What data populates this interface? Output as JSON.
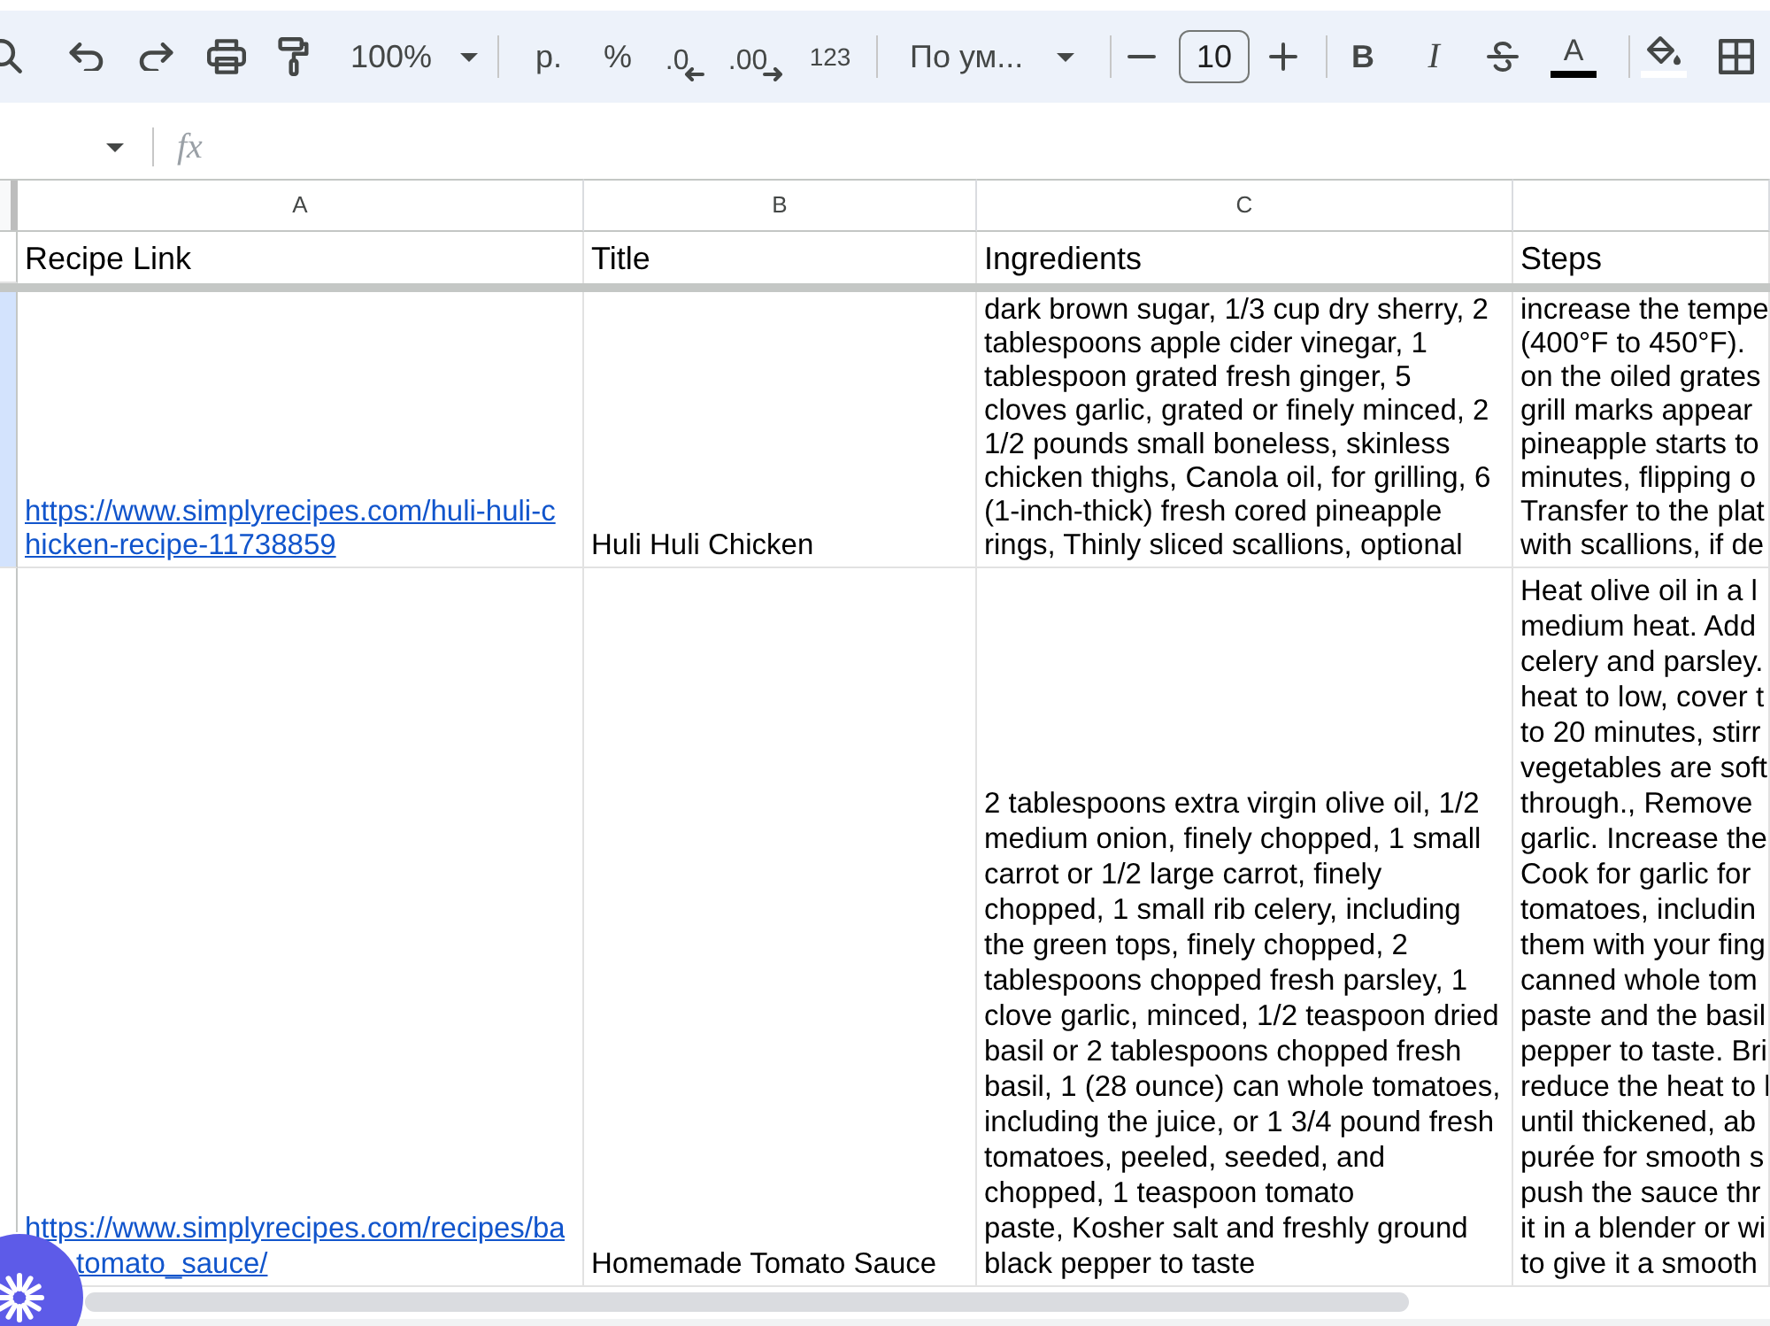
{
  "toolbar": {
    "zoom": "100%",
    "currency": "р.",
    "percent": "%",
    "decrease_decimal": ".0",
    "increase_decimal": ".00",
    "number_format": "123",
    "font": "По ум...",
    "font_size": "10",
    "bold": "B",
    "italic": "I",
    "text_color": "A"
  },
  "formula_bar": {
    "fx": "fx"
  },
  "sheet": {
    "column_letters": [
      "A",
      "B",
      "C"
    ],
    "header_row": {
      "selected": false,
      "cells": [
        "Recipe Link",
        "Title",
        "Ingredients",
        "Steps"
      ]
    },
    "rows": [
      {
        "selected": true,
        "link": [
          "https://www.simplyrecipes.com/huli-huli-c",
          "hicken-recipe-11738859"
        ],
        "title": "Huli Huli Chicken",
        "ingredients": [
          "dark brown sugar, 1/3 cup dry sherry, 2",
          "tablespoons apple cider vinegar, 1",
          "tablespoon grated fresh ginger, 5",
          "cloves garlic, grated or finely minced, 2",
          "1/2 pounds small boneless, skinless",
          "chicken thighs, Canola oil, for grilling, 6",
          "(1-inch-thick) fresh cored pineapple",
          "rings, Thinly sliced scallions, optional"
        ],
        "steps": [
          "increase the tempe",
          "(400°F to 450°F).",
          "on the oiled grates",
          "grill marks appear",
          "pineapple starts to",
          "minutes, flipping o",
          "Transfer to the plat",
          "with scallions, if de"
        ]
      },
      {
        "selected": false,
        "link": [
          "https://www.simplyrecipes.com/recipes/ba",
          "tomato_sauce/"
        ],
        "title": "Homemade Tomato Sauce",
        "ingredients": [
          "2 tablespoons extra virgin olive oil, 1/2",
          "medium onion, finely chopped, 1 small",
          "carrot or 1/2 large carrot, finely",
          "chopped, 1 small rib celery, including",
          "the green tops, finely chopped, 2",
          "tablespoons chopped fresh parsley, 1",
          "clove garlic, minced, 1/2 teaspoon dried",
          "basil or 2 tablespoons chopped fresh",
          "basil, 1 (28 ounce) can whole tomatoes,",
          "including the juice, or 1 3/4 pound fresh",
          "tomatoes, peeled, seeded, and",
          "chopped, 1 teaspoon tomato",
          "paste, Kosher salt and freshly ground",
          "black pepper to taste"
        ],
        "steps": [
          "Heat olive oil in a l",
          "medium heat. Add",
          "celery and parsley.",
          "heat to low, cover t",
          "to 20 minutes, stirr",
          "vegetables are soft",
          "through., Remove",
          "garlic. Increase the",
          "Cook for garlic for",
          "tomatoes, includin",
          "them with your fing",
          "canned whole tom",
          "paste and the basil",
          "pepper to taste. Bri",
          "reduce the heat to l",
          "until thickened, ab",
          "purée for smooth s",
          "push the sauce thr",
          "it in a blender or wi",
          "to give it a smooth"
        ]
      }
    ]
  }
}
